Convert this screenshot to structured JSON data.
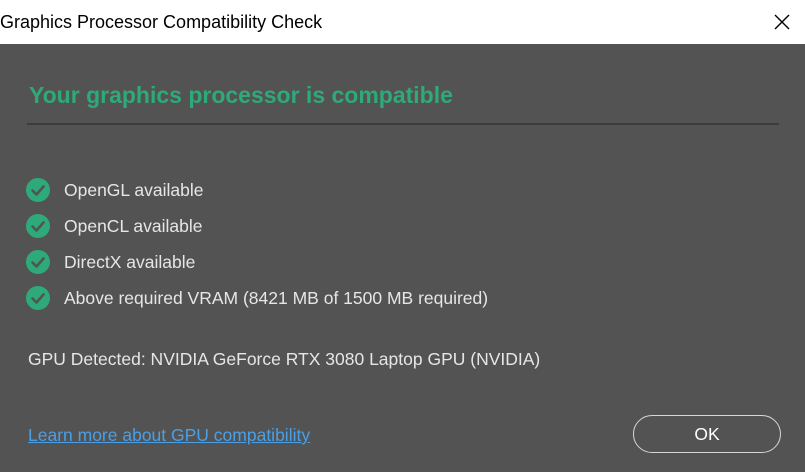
{
  "window": {
    "title": "Graphics Processor Compatibility Check",
    "close_icon": "close-icon"
  },
  "headline": "Your graphics processor is compatible",
  "checks": [
    {
      "label": "OpenGL available",
      "icon": "check-circle-icon",
      "status": "pass"
    },
    {
      "label": "OpenCL available",
      "icon": "check-circle-icon",
      "status": "pass"
    },
    {
      "label": "DirectX available",
      "icon": "check-circle-icon",
      "status": "pass"
    },
    {
      "label": "Above required VRAM (8421 MB of 1500 MB required)",
      "icon": "check-circle-icon",
      "status": "pass"
    }
  ],
  "gpu_detected": "GPU Detected: NVIDIA GeForce RTX 3080 Laptop GPU (NVIDIA)",
  "learn_more_link": "Learn more about GPU compatibility",
  "ok_button": "OK",
  "colors": {
    "background": "#535353",
    "titlebar": "#ffffff",
    "accent_green": "#2eaa7a",
    "check_green": "#2eaa7a",
    "link_blue": "#4a9fe6",
    "text": "#e6e6e6"
  }
}
